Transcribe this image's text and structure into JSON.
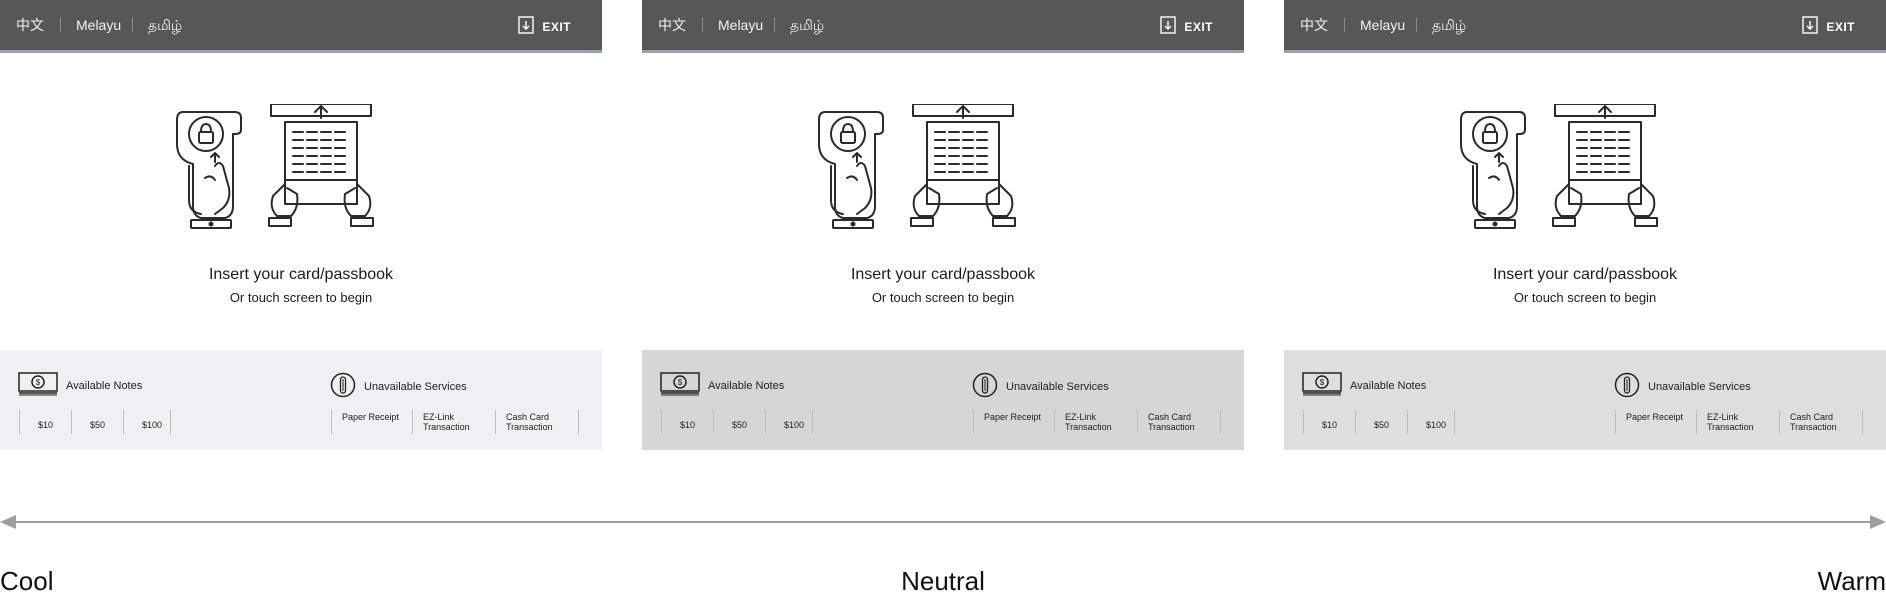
{
  "screens": [
    {
      "name": "cool",
      "footer_color": "#efeff4",
      "languages": [
        "中文",
        "Melayu",
        "தமிழ்"
      ],
      "exit_label": "EXIT",
      "prompt_main": "Insert your card/passbook",
      "prompt_sub": "Or touch screen to begin",
      "notes_title": "Available Notes",
      "notes": [
        "$10",
        "$50",
        "$100"
      ],
      "services_title": "Unavailable Services",
      "services": [
        "Paper Receipt",
        "EZ-Link\nTransaction",
        "Cash Card\nTransaction"
      ]
    },
    {
      "name": "neutral",
      "footer_color": "#d6d6d6",
      "languages": [
        "中文",
        "Melayu",
        "தமிழ்"
      ],
      "exit_label": "EXIT",
      "prompt_main": "Insert your card/passbook",
      "prompt_sub": "Or touch screen to begin",
      "notes_title": "Available Notes",
      "notes": [
        "$10",
        "$50",
        "$100"
      ],
      "services_title": "Unavailable Services",
      "services": [
        "Paper Receipt",
        "EZ-Link\nTransaction",
        "Cash Card\nTransaction"
      ]
    },
    {
      "name": "warm",
      "footer_color": "#dedede",
      "languages": [
        "中文",
        "Melayu",
        "தமிழ்"
      ],
      "exit_label": "EXIT",
      "prompt_main": "Insert your card/passbook",
      "prompt_sub": "Or touch screen to begin",
      "notes_title": "Available Notes",
      "notes": [
        "$10",
        "$50",
        "$100"
      ],
      "services_title": "Unavailable Services",
      "services": [
        "Paper Receipt",
        "EZ-Link\nTransaction",
        "Cash Card\nTransaction"
      ]
    }
  ],
  "axis": {
    "left_label": "Cool",
    "center_label": "Neutral",
    "right_label": "Warm"
  },
  "colors": {
    "topbar": "#575757",
    "topbar_accent": "#9aa3ad",
    "axis_line": "#9e9e9e"
  }
}
